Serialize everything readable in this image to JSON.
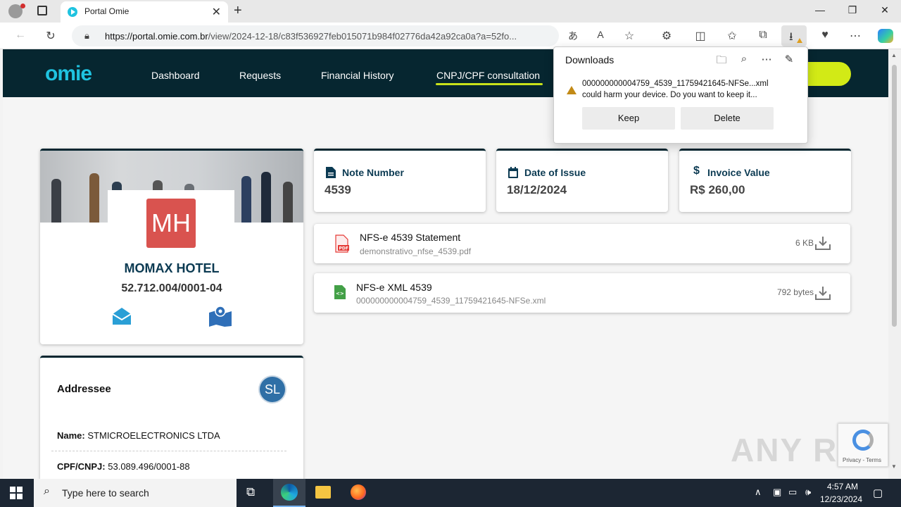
{
  "browser": {
    "tab_title": "Portal Omie",
    "url_domain": "https://portal.omie.com.br",
    "url_rest": "/view/2024-12-18/c83f536927feb015071b984f02776da42a92ca0a?a=52fo..."
  },
  "site": {
    "logo": "omie",
    "nav": [
      "Dashboard",
      "Requests",
      "Financial History",
      "CNPJ/CPF consultation"
    ],
    "accent": "#c8e21a",
    "header_bg": "#062630"
  },
  "company": {
    "initials": "MH",
    "name": "MOMAX HOTEL",
    "cnpj": "52.712.004/0001-04"
  },
  "addressee": {
    "title": "Addressee",
    "initials": "SL",
    "name_label": "Name:",
    "name_value": "STMICROELECTRONICS LTDA",
    "doc_label": "CPF/CNPJ:",
    "doc_value": "53.089.496/0001-88"
  },
  "info": {
    "note_label": "Note Number",
    "note_value": "4539",
    "date_label": "Date of Issue",
    "date_value": "18/12/2024",
    "value_label": "Invoice Value",
    "value_value": "R$ 260,00"
  },
  "files": [
    {
      "title": "NFS-e 4539 Statement",
      "filename": "demonstrativo_nfse_4539.pdf",
      "size": "6 KB",
      "icon": "pdf-file-icon"
    },
    {
      "title": "NFS-e XML 4539",
      "filename": "000000000004759_4539_11759421645-NFSe.xml",
      "size": "792 bytes",
      "icon": "xml-file-icon"
    }
  ],
  "downloads": {
    "title": "Downloads",
    "file": "000000000004759_4539_11759421645-NFSe...xml",
    "message": "could harm your device. Do you want to keep it...",
    "keep": "Keep",
    "delete": "Delete"
  },
  "recaptcha": {
    "text": "Privacy - Terms"
  },
  "watermark": "ANY RUN",
  "taskbar": {
    "search_placeholder": "Type here to search",
    "time": "4:57 AM",
    "date": "12/23/2024"
  }
}
